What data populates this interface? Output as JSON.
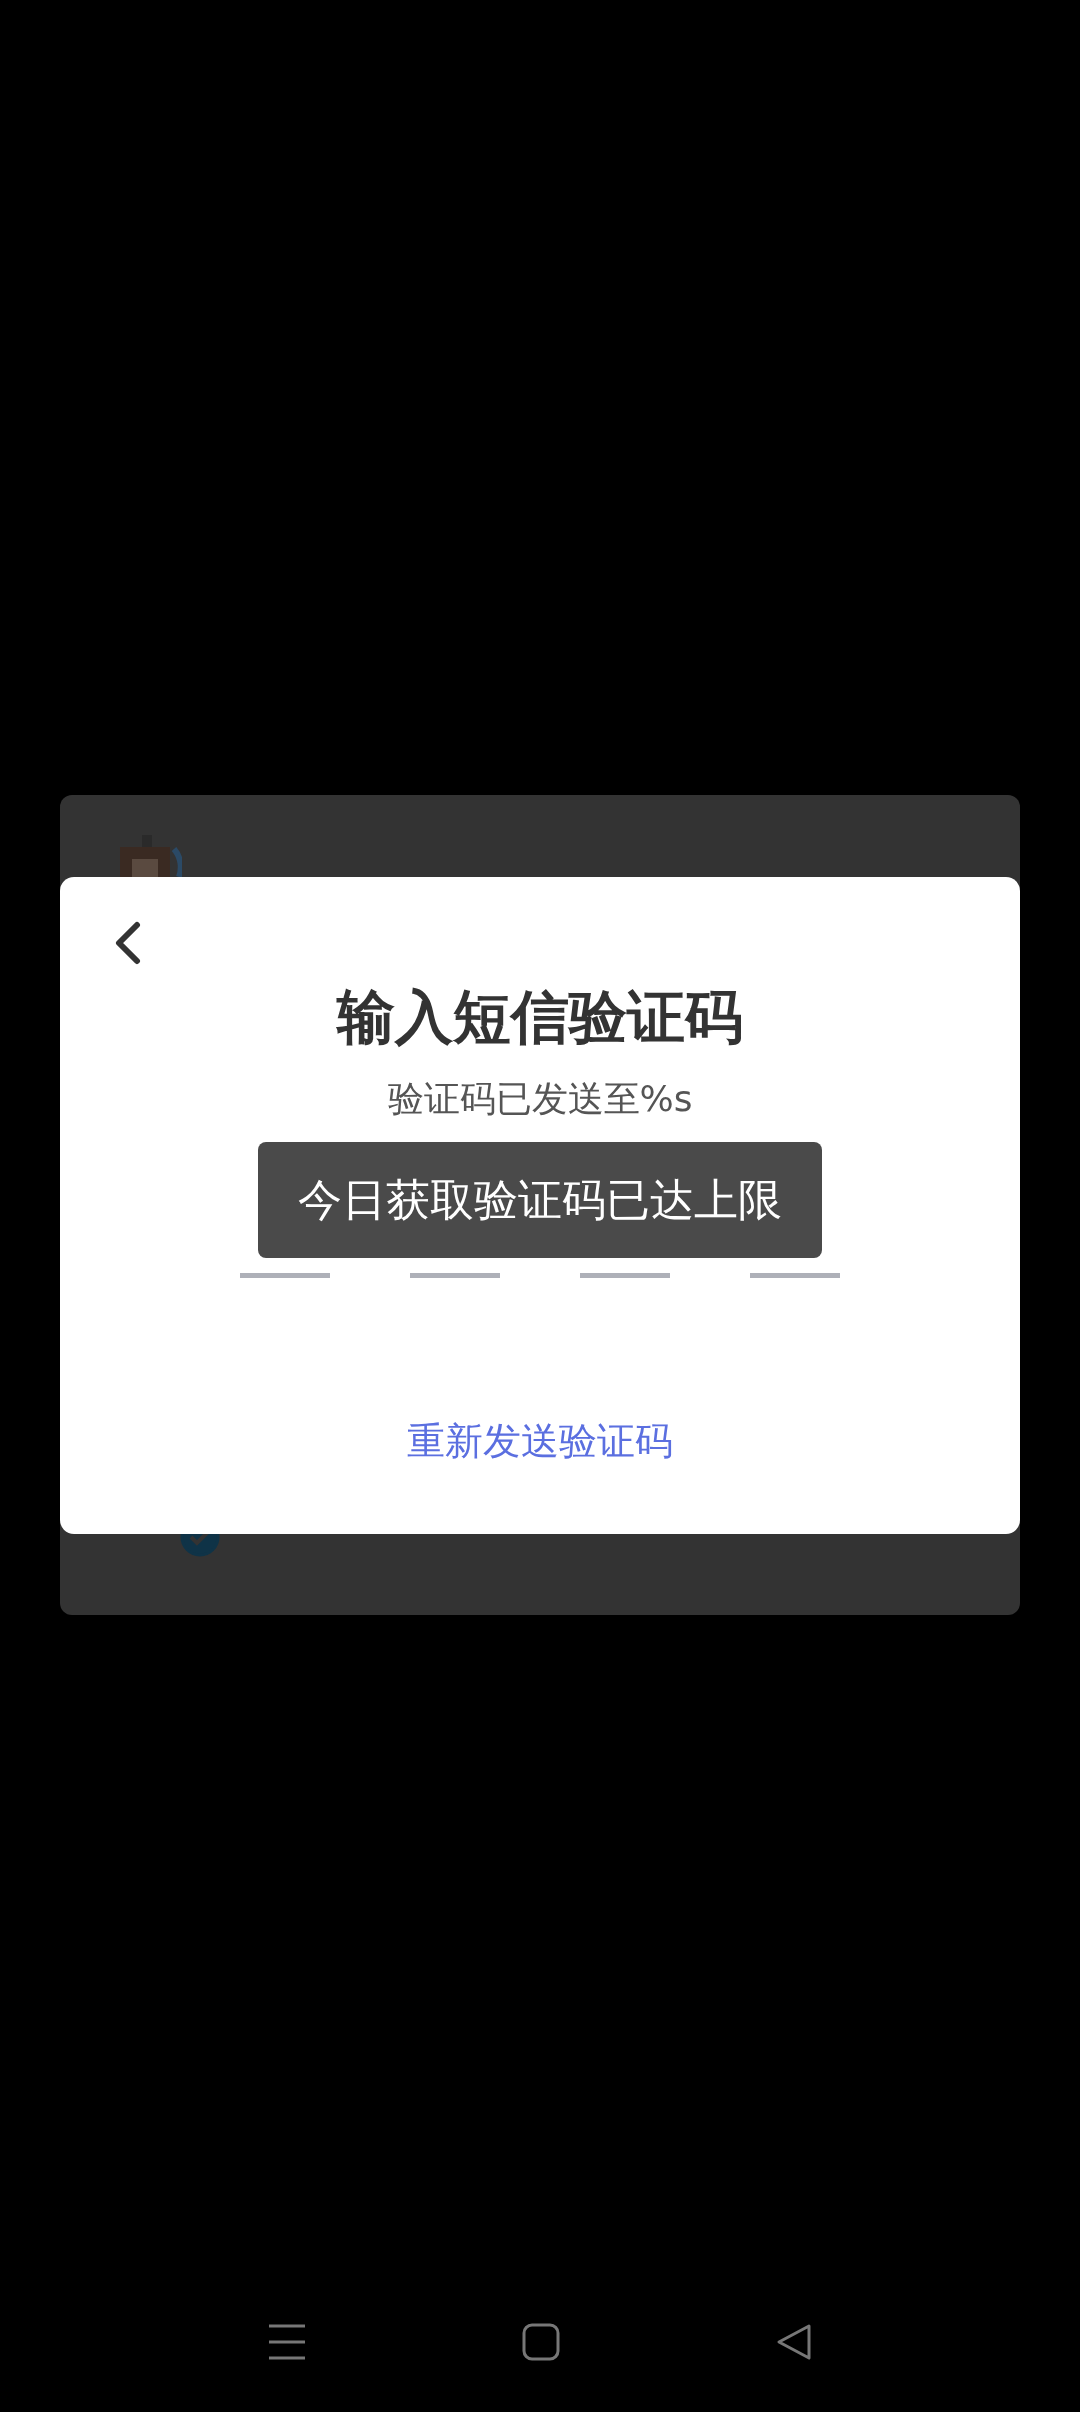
{
  "background_card": {
    "agreement": {
      "checked": true
    }
  },
  "dialog": {
    "title": "输入短信验证码",
    "subtitle": "验证码已发送至%s",
    "code_slots": [
      {
        "kind": "digit"
      },
      {
        "kind": "digit"
      },
      {
        "kind": "digit"
      },
      {
        "kind": "digit"
      }
    ],
    "resend_link": "重新发送验证码"
  },
  "toast": "今日获取验证码已达上限"
}
